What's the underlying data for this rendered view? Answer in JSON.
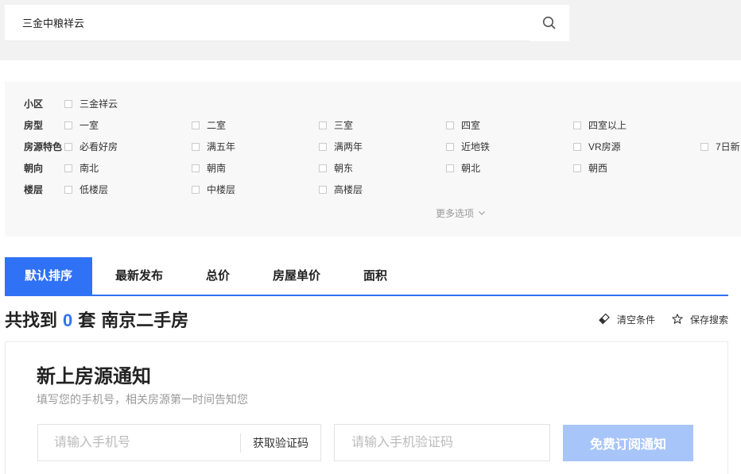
{
  "search": {
    "value": "三金中粮祥云"
  },
  "filters": {
    "rows": [
      {
        "label": "小区",
        "options": [
          "三金祥云"
        ]
      },
      {
        "label": "房型",
        "options": [
          "一室",
          "二室",
          "三室",
          "四室",
          "四室以上"
        ]
      },
      {
        "label": "房源特色",
        "options": [
          "必看好房",
          "满五年",
          "满两年",
          "近地铁",
          "VR房源",
          "7日新"
        ]
      },
      {
        "label": "朝向",
        "options": [
          "南北",
          "朝南",
          "朝东",
          "朝北",
          "朝西"
        ]
      },
      {
        "label": "楼层",
        "options": [
          "低楼层",
          "中楼层",
          "高楼层"
        ]
      }
    ],
    "more_options": "更多选项"
  },
  "sort_tabs": [
    {
      "label": "默认排序",
      "active": true
    },
    {
      "label": "最新发布",
      "active": false
    },
    {
      "label": "总价",
      "active": false
    },
    {
      "label": "房屋单价",
      "active": false
    },
    {
      "label": "面积",
      "active": false
    }
  ],
  "result": {
    "prefix": "共找到",
    "count": 0,
    "unit": "套",
    "category": "南京二手房",
    "clear_label": "清空条件",
    "save_label": "保存搜索"
  },
  "subscription": {
    "title": "新上房源通知",
    "subtitle": "填写您的手机号，相关房源第一时间告知您",
    "phone_placeholder": "请输入手机号",
    "get_code_label": "获取验证码",
    "code_placeholder": "请输入手机验证码",
    "submit_label": "免费订阅通知"
  },
  "icons": {
    "search": "search-icon",
    "more_options": "chevron-down-icon",
    "clear": "eraser-icon",
    "save": "star-icon"
  },
  "colors": {
    "accent": "#3072f6",
    "subscribe_button": "#a8c5fa"
  }
}
